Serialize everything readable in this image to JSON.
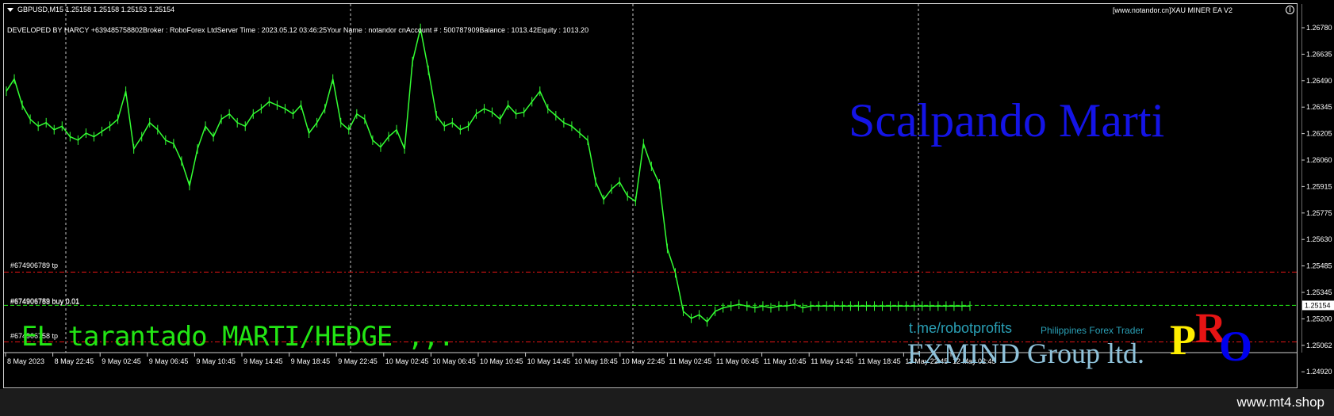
{
  "header": {
    "symbol_line": "GBPUSD,M15  1.25158 1.25158 1.25153 1.25154",
    "dev_info": "DEVELOPED BY HARCY +639485758802Broker  : RoboForex LtdServer Time : 2023.05.12 03:46:25Your Name    : notandor cnAccount #   : 500787909Balance : 1013.42Equity   : 1013.20",
    "ea_badge": "[www.notandor.cn]XAU MINER EA V2"
  },
  "order_labels": {
    "tp_upper": "#674906789 tp",
    "buy_overlap_a": "#674906789 buy 0.01",
    "buy_overlap_b": "#674906758 buy 0.01",
    "tp_lower": "#674906758 tp"
  },
  "overlays": {
    "scalpando": "Scalpando Marti",
    "tarantado": "EL tarantado MARTI/HEDGE  ,,.",
    "tme_link": "t.me/robotprofits",
    "ph_trader": "Philippines Forex Trader",
    "fxmind": "FXMIND Group ltd.",
    "pro_p": "P",
    "pro_r": "R",
    "pro_o": "O"
  },
  "price_axis": {
    "labels": [
      "1.26780",
      "1.26635",
      "1.26490",
      "1.26345",
      "1.26205",
      "1.26060",
      "1.25915",
      "1.25775",
      "1.25630",
      "1.25485",
      "1.25345",
      "1.25200",
      "1.25062",
      "1.24920"
    ],
    "current_price": "1.25154"
  },
  "time_axis": {
    "labels": [
      "8 May 2023",
      "8 May 22:45",
      "9 May 02:45",
      "9 May 06:45",
      "9 May 10:45",
      "9 May 14:45",
      "9 May 18:45",
      "9 May 22:45",
      "10 May 02:45",
      "10 May 06:45",
      "10 May 10:45",
      "10 May 14:45",
      "10 May 18:45",
      "10 May 22:45",
      "11 May 02:45",
      "11 May 06:45",
      "11 May 10:45",
      "11 May 14:45",
      "11 May 18:45",
      "11 May 22:45",
      "12 May 02:45"
    ]
  },
  "chart_data": {
    "type": "line",
    "ylim": [
      1.2492,
      1.2678
    ],
    "grid": "vertical-dashed",
    "candle_color": "#33ff33",
    "x": [
      0,
      10,
      20,
      30,
      40,
      50,
      60,
      70,
      80,
      90,
      100,
      110,
      120,
      130,
      140,
      150,
      160,
      170,
      180,
      190,
      200,
      210,
      220,
      230,
      240,
      250,
      260,
      270,
      280,
      290,
      300,
      310,
      320,
      330,
      340,
      350,
      360,
      370,
      380,
      390,
      400,
      410,
      420,
      430,
      440,
      450,
      460,
      470,
      480,
      490,
      500,
      510,
      520,
      530,
      540,
      550,
      560,
      570,
      580,
      590,
      600,
      610,
      620,
      630,
      640,
      650,
      660,
      670,
      680,
      690,
      700,
      710,
      720,
      730,
      740,
      750,
      760,
      770,
      780,
      790,
      800,
      810,
      820,
      830,
      840,
      850,
      860,
      870,
      880,
      890,
      900,
      910,
      920,
      930,
      940,
      950,
      960,
      970,
      980,
      990,
      1000,
      1010,
      1020,
      1030,
      1040,
      1050,
      1060,
      1070,
      1080,
      1090,
      1100,
      1110,
      1120,
      1130,
      1140,
      1150,
      1160,
      1170,
      1180,
      1190,
      1200,
      1210
    ],
    "y": [
      1.2638,
      1.2645,
      1.263,
      1.2622,
      1.2618,
      1.262,
      1.2616,
      1.2618,
      1.2612,
      1.261,
      1.2614,
      1.2612,
      1.2615,
      1.2618,
      1.2622,
      1.2638,
      1.2605,
      1.2612,
      1.262,
      1.2616,
      1.261,
      1.2608,
      1.2598,
      1.2584,
      1.2605,
      1.2618,
      1.2612,
      1.2622,
      1.2625,
      1.262,
      1.2618,
      1.2625,
      1.2628,
      1.2632,
      1.263,
      1.2628,
      1.2625,
      1.263,
      1.2614,
      1.262,
      1.2628,
      1.2645,
      1.262,
      1.2616,
      1.2625,
      1.2622,
      1.261,
      1.2606,
      1.2612,
      1.2616,
      1.2605,
      1.2655,
      1.2674,
      1.265,
      1.2624,
      1.2618,
      1.262,
      1.2616,
      1.2618,
      1.2625,
      1.2628,
      1.2626,
      1.2622,
      1.263,
      1.2625,
      1.2626,
      1.2632,
      1.2638,
      1.2628,
      1.2624,
      1.262,
      1.2618,
      1.2614,
      1.261,
      1.2586,
      1.2576,
      1.2582,
      1.2586,
      1.2578,
      1.2575,
      1.2608,
      1.2595,
      1.2585,
      1.2548,
      1.2534,
      1.2512,
      1.2508,
      1.251,
      1.2506,
      1.2512,
      1.2514,
      1.2515,
      1.2516,
      1.2515,
      1.2514,
      1.2515,
      1.2514,
      1.2515,
      1.2515,
      1.2516,
      1.2514,
      1.2515,
      1.2515,
      1.2515,
      1.2515,
      1.2515,
      1.2515,
      1.2515,
      1.2515,
      1.2515,
      1.2515,
      1.2515,
      1.2515,
      1.2515,
      1.2515,
      1.2515,
      1.2515,
      1.2515,
      1.2515,
      1.2515,
      1.2515,
      1.2515
    ]
  },
  "levels": {
    "tp_upper": 1.25345,
    "current": 1.25154,
    "tp_lower": 1.24945
  },
  "colors": {
    "background": "#000000",
    "candles": "#33ff33",
    "tp_line": "#e61414",
    "current_line": "#22e614",
    "grid": "#c8c8c8"
  }
}
